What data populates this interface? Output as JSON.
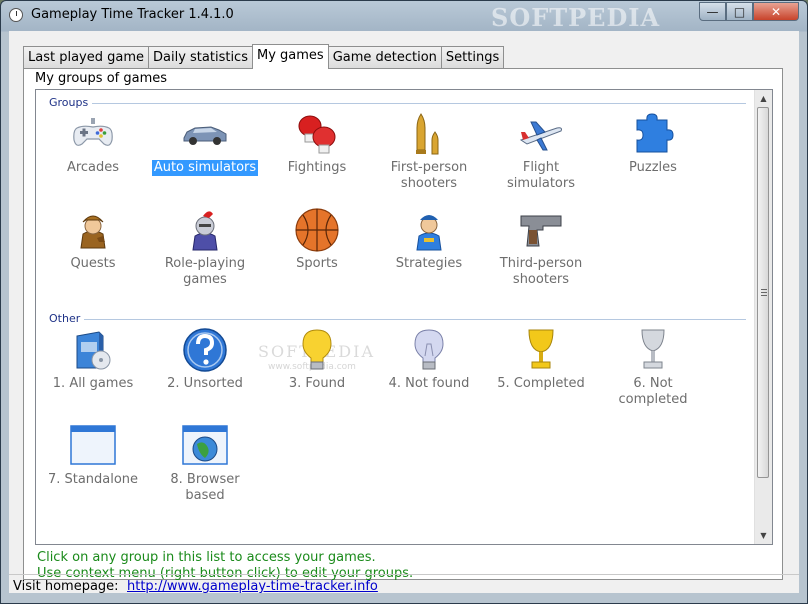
{
  "window": {
    "title": "Gameplay Time Tracker 1.4.1.0",
    "watermark": "SOFTPEDIA",
    "min_label": "—",
    "max_label": "□",
    "close_label": "✕"
  },
  "tabs": [
    {
      "label": "Last played game"
    },
    {
      "label": "Daily statistics"
    },
    {
      "label": "My games",
      "active": true
    },
    {
      "label": "Game detection"
    },
    {
      "label": "Settings"
    }
  ],
  "panel": {
    "groupbox_title": "My groups of games",
    "sections": {
      "groups": "Groups",
      "other": "Other"
    },
    "groups": [
      {
        "label": "Arcades",
        "icon": "gamepad-icon"
      },
      {
        "label": "Auto simulators",
        "icon": "car-icon",
        "selected": true
      },
      {
        "label": "Fightings",
        "icon": "boxing-gloves-icon"
      },
      {
        "label": "First-person shooters",
        "icon": "bullet-icon"
      },
      {
        "label": "Flight simulators",
        "icon": "airplane-icon"
      },
      {
        "label": "Puzzles",
        "icon": "puzzle-piece-icon"
      },
      {
        "label": "Quests",
        "icon": "detective-icon"
      },
      {
        "label": "Role-playing games",
        "icon": "knight-icon"
      },
      {
        "label": "Sports",
        "icon": "basketball-icon"
      },
      {
        "label": "Strategies",
        "icon": "commander-icon"
      },
      {
        "label": "Third-person shooters",
        "icon": "pistol-icon"
      }
    ],
    "other": [
      {
        "label": "1. All games",
        "icon": "software-box-icon"
      },
      {
        "label": "2. Unsorted",
        "icon": "question-icon"
      },
      {
        "label": "3. Found",
        "icon": "lightbulb-on-icon"
      },
      {
        "label": "4. Not found",
        "icon": "lightbulb-off-icon"
      },
      {
        "label": "5. Completed",
        "icon": "gold-cup-icon"
      },
      {
        "label": "6. Not completed",
        "icon": "silver-cup-icon"
      },
      {
        "label": "7. Standalone",
        "icon": "window-icon"
      },
      {
        "label": "8. Browser based",
        "icon": "browser-globe-icon"
      }
    ],
    "hints": [
      "Click on any group in this list to access your games.",
      "Use context menu (right button click) to edit your groups."
    ]
  },
  "listview_watermark": {
    "text": "SOFTPEDIA",
    "url": "www.softpedia.com"
  },
  "status": {
    "label": "Visit homepage:",
    "link": "http://www.gameplay-time-tracker.info"
  },
  "colors": {
    "selection": "#3399ff",
    "hint_text": "#1a8a1a",
    "section_header": "#1e3287",
    "link": "#0000cc"
  }
}
